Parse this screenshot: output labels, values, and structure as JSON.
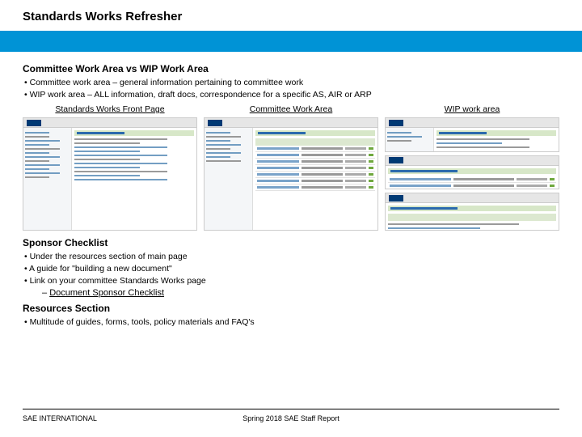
{
  "header": {
    "title": "Standards Works Refresher"
  },
  "section1": {
    "title": "Committee Work Area vs WIP Work Area",
    "bullets": [
      "Committee work area – general information pertaining to committee work",
      "WIP work area – ALL information, draft docs, correspondence for a specific AS, AIR or ARP"
    ]
  },
  "screenshots": {
    "col1": "Standards Works Front Page",
    "col2": "Committee Work Area",
    "col3": "WIP work area"
  },
  "section2": {
    "title": "Sponsor Checklist",
    "bullets": [
      "Under the resources section of main page",
      "A guide for \"building a new document\"",
      "Link on your committee Standards Works page"
    ],
    "sub": "Document Sponsor Checklist"
  },
  "section3": {
    "title": "Resources Section",
    "bullets": [
      "Multitude of guides, forms, tools, policy materials and FAQ's"
    ]
  },
  "footer": {
    "left": "SAE INTERNATIONAL",
    "center": "Spring 2018 SAE Staff Report"
  }
}
